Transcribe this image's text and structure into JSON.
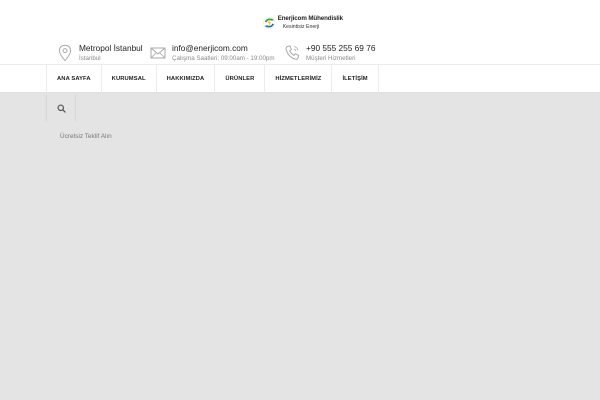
{
  "header": {
    "logo": {
      "line1": "Enerjicom Mühendislik",
      "line2": "Kesintisiz Enerji",
      "colors": {
        "green": "#2e9e3e",
        "blue": "#1f6fb8"
      }
    },
    "location": {
      "icon": "map-pin-icon",
      "title": "Metropol İstanbul",
      "subtitle": "İstanbul"
    },
    "email": {
      "icon": "envelope-icon",
      "title": "info@enerjicom.com",
      "subtitle": "Çalışma Saatleri: 09:00am - 19:00pm"
    },
    "phone": {
      "icon": "phone-icon",
      "title": "+90 555 255 69 76",
      "subtitle": "Müşteri Hizmetleri"
    }
  },
  "nav": {
    "items": [
      {
        "label": "ANA SAYFA"
      },
      {
        "label": "KURUMSAL"
      },
      {
        "label": "HAKKIMIZDA"
      },
      {
        "label": "ÜRÜNLER"
      },
      {
        "label": "HİZMETLERİMİZ"
      },
      {
        "label": "İLETİŞİM"
      }
    ],
    "search_icon": "search-icon"
  },
  "main": {
    "quote_link": "Ücretsiz Teklif Alın"
  },
  "colors": {
    "page_bg": "#e4e4e4",
    "header_bg": "#ffffff",
    "text": "#222222",
    "muted": "#8a8a8a"
  }
}
